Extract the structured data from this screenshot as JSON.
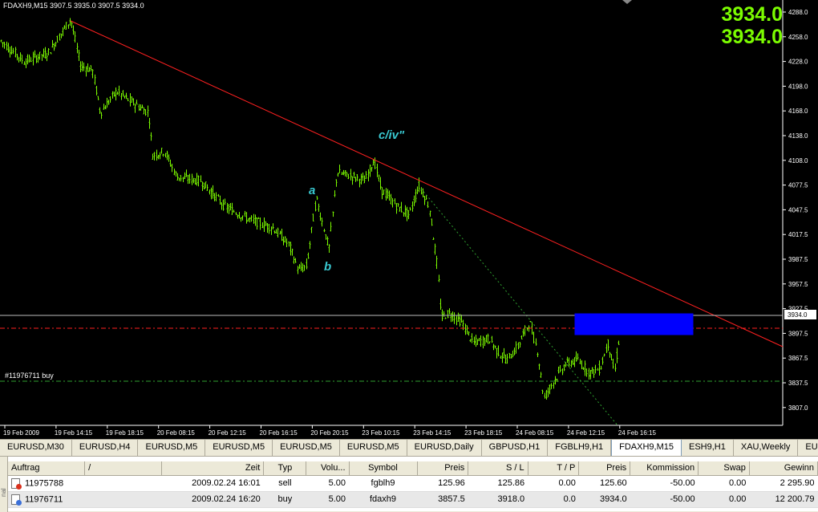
{
  "chart": {
    "header": "FDAXH9,M15  3907.5 3935.0 3907.5 3934.0",
    "big_price_1": "3934.0",
    "big_price_2": "3934.0",
    "price_labels": [
      "4288.0",
      "4258.0",
      "4228.0",
      "4198.0",
      "4168.0",
      "4138.0",
      "4108.0",
      "4077.5",
      "4047.5",
      "4017.5",
      "3987.5",
      "3957.5",
      "3927.5",
      "3897.5",
      "3867.5",
      "3837.5",
      "3807.0"
    ],
    "current_price_tag": "3934.0",
    "time_labels": [
      "19 Feb 2009",
      "19 Feb 14:15",
      "19 Feb 18:15",
      "20 Feb 08:15",
      "20 Feb 12:15",
      "20 Feb 16:15",
      "20 Feb 20:15",
      "23 Feb 10:15",
      "23 Feb 14:15",
      "23 Feb 18:15",
      "24 Feb 08:15",
      "24 Feb 12:15",
      "24 Feb 16:15"
    ],
    "annotations": {
      "a": "a",
      "b": "b",
      "civ": "c/iv\""
    },
    "order_label": "#11976711 buy",
    "colors": {
      "bg": "#000000",
      "candles": "#7cfc00",
      "trendline": "#ff2020",
      "box": "#0000ff",
      "text": "#ffffff",
      "wave": "#39c8d0"
    }
  },
  "tabs": [
    "EURUSD,M30",
    "EURUSD,H4",
    "EURUSD,M5",
    "EURUSD,M5",
    "EURUSD,M5",
    "EURUSD,M5",
    "EURUSD,Daily",
    "GBPUSD,H1",
    "FGBLH9,H1",
    "FDAXH9,M15",
    "ESH9,H1",
    "XAU,Weekly",
    "EU"
  ],
  "active_tab": "FDAXH9,M15",
  "terminal": {
    "side_label": "nal",
    "columns": [
      "Auftrag",
      "/",
      "Zeit",
      "Typ",
      "Volu...",
      "Symbol",
      "Preis",
      "S / L",
      "T / P",
      "Preis",
      "Kommission",
      "Swap",
      "Gewinn"
    ],
    "rows": [
      {
        "order": "11975788",
        "time": "2009.02.24 16:01",
        "type": "sell",
        "volume": "5.00",
        "symbol": "fgblh9",
        "price": "125.96",
        "sl": "125.86",
        "tp": "0.00",
        "cur": "125.60",
        "commission": "-50.00",
        "swap": "0.00",
        "profit": "2 295.90",
        "icon_color": "#d9301c"
      },
      {
        "order": "11976711",
        "time": "2009.02.24 16:20",
        "type": "buy",
        "volume": "5.00",
        "symbol": "fdaxh9",
        "price": "3857.5",
        "sl": "3918.0",
        "tp": "0.0",
        "cur": "3934.0",
        "commission": "-50.00",
        "swap": "0.00",
        "profit": "12 200.79",
        "icon_color": "#3a6fd8"
      }
    ]
  }
}
